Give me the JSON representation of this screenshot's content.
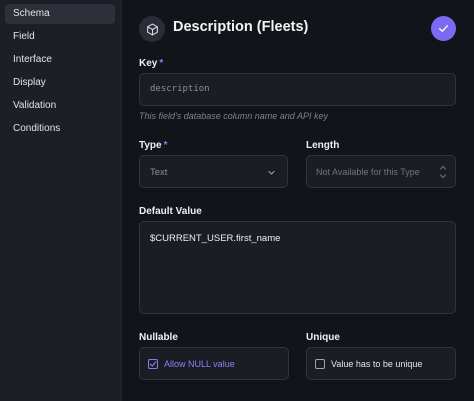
{
  "sidebar": {
    "items": [
      {
        "label": "Schema"
      },
      {
        "label": "Field"
      },
      {
        "label": "Interface"
      },
      {
        "label": "Display"
      },
      {
        "label": "Validation"
      },
      {
        "label": "Conditions"
      }
    ],
    "active_index": 0
  },
  "header": {
    "title": "Description (Fleets)",
    "icon": "cube-icon",
    "save_icon": "check-icon"
  },
  "key": {
    "label": "Key",
    "required_marker": "*",
    "value": "description",
    "hint": "This field's database column name and API key"
  },
  "type": {
    "label": "Type",
    "required_marker": "*",
    "value": "Text"
  },
  "length": {
    "label": "Length",
    "placeholder": "Not Available for this Type"
  },
  "default_value": {
    "label": "Default Value",
    "value": "$CURRENT_USER.first_name"
  },
  "nullable": {
    "label": "Nullable",
    "checkbox_label": "Allow NULL value",
    "checked": true
  },
  "unique": {
    "label": "Unique",
    "checkbox_label": "Value has to be unique",
    "checked": false
  },
  "colors": {
    "accent": "#7c6af5",
    "background": "#121419",
    "sidebar": "#1c1f26"
  }
}
